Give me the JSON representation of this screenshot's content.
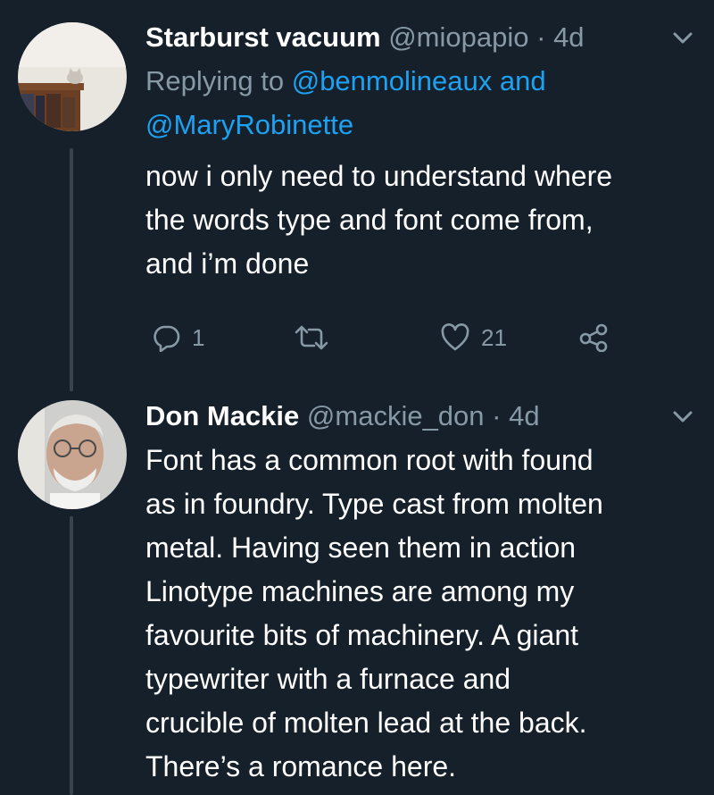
{
  "tweets": [
    {
      "display_name": "Starburst vacuum",
      "handle": "@miopapio",
      "separator": "·",
      "time": "4d",
      "reply_prefix": "Replying to",
      "reply_mention_1": "@benmolineaux",
      "reply_and": "and",
      "reply_mention_2": "@MaryRobinette",
      "text_lines": [
        "now i only need to understand where",
        "the words type and font come from,",
        "and i’m done"
      ],
      "reply_count": "1",
      "like_count": "21",
      "icons": {
        "reply": "reply-icon",
        "retweet": "retweet-icon",
        "like": "like-icon",
        "share": "share-icon",
        "menu": "chevron-down-icon"
      }
    },
    {
      "display_name": "Don Mackie",
      "handle": "@mackie_don",
      "separator": "·",
      "time": "4d",
      "text_lines": [
        "Font has a common root with found",
        "as in foundry. Type cast from molten",
        "metal.  Having seen them in action",
        "Linotype machines are among my",
        "favourite bits of machinery. A giant",
        "typewriter with a furnace and",
        "crucible of molten lead at the back.",
        "There’s a romance here."
      ],
      "icons": {
        "menu": "chevron-down-icon"
      }
    }
  ],
  "colors": {
    "background": "#15202b",
    "secondary_text": "#8899a6",
    "link": "#1da1f2",
    "thread_line": "#38444d"
  }
}
